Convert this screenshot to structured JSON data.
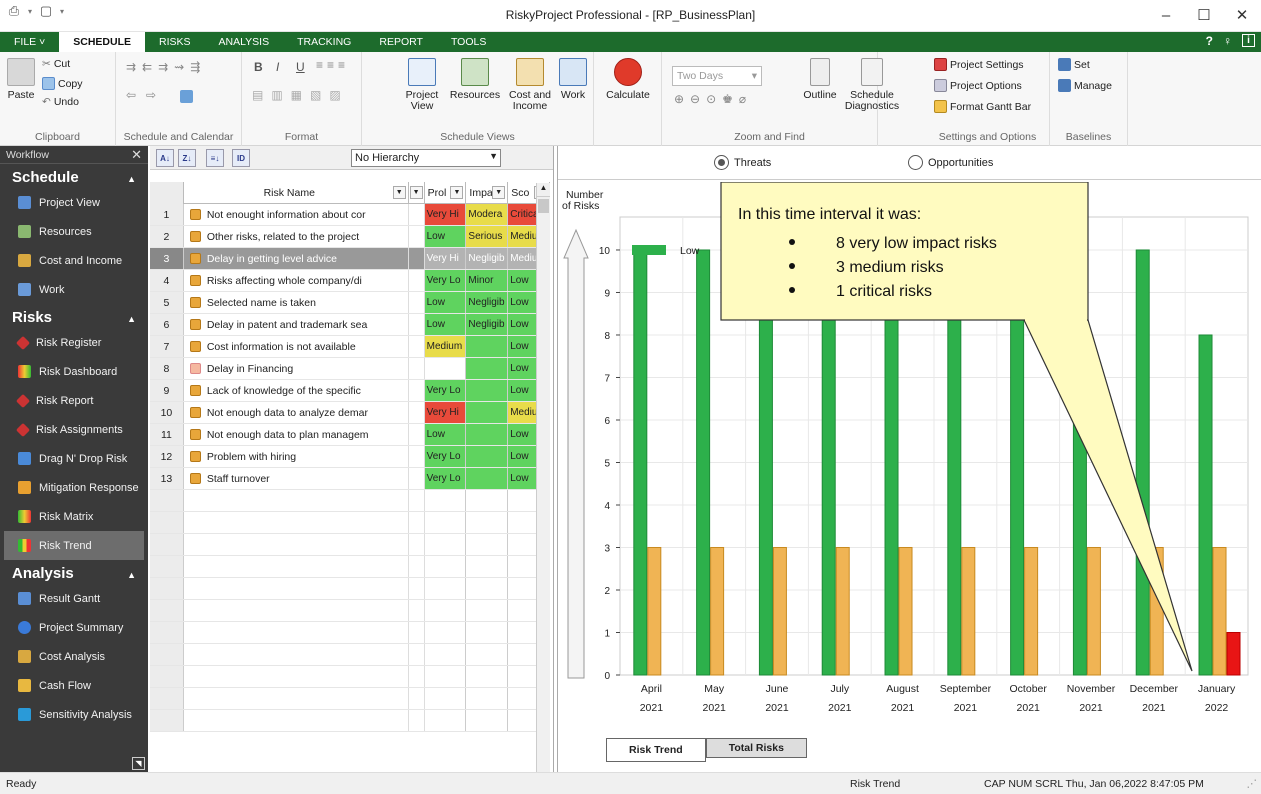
{
  "window": {
    "title": "RiskyProject Professional - [RP_BusinessPlan]",
    "minimize": "–",
    "maximize": "☐",
    "close": "✕"
  },
  "ribbon_tabs": [
    "FILE ˅",
    "SCHEDULE",
    "RISKS",
    "ANALYSIS",
    "TRACKING",
    "REPORT",
    "TOOLS"
  ],
  "ribbon_right": {
    "help": "?",
    "comment": "♀",
    "info": "i"
  },
  "clipboard": {
    "paste": "Paste",
    "cut": "Cut",
    "copy": "Copy",
    "undo": "Undo",
    "group": "Clipboard"
  },
  "groups": {
    "schedule_calendar": "Schedule and Calendar",
    "format": "Format",
    "schedule_views": "Schedule Views",
    "zoom_find": "Zoom and Find",
    "settings_options": "Settings and Options",
    "baselines": "Baselines"
  },
  "format": {
    "bold": "B",
    "italic": "I",
    "underline": "U"
  },
  "views": {
    "project": "Project View",
    "resources": "Resources",
    "cost": "Cost and Income",
    "work": "Work"
  },
  "calculate": "Calculate",
  "zoom": {
    "combo": "Two Days",
    "outline": "Outline",
    "diagnostics": "Schedule Diagnostics"
  },
  "settings": {
    "project_settings": "Project Settings",
    "project_options": "Project Options",
    "format_gantt": "Format Gantt Bar"
  },
  "baselines": {
    "set": "Set",
    "manage": "Manage"
  },
  "workflow": {
    "title": "Workflow",
    "close": "✕",
    "sections": [
      {
        "name": "Schedule",
        "items": [
          "Project View",
          "Resources",
          "Cost and Income",
          "Work"
        ]
      },
      {
        "name": "Risks",
        "items": [
          "Risk Register",
          "Risk Dashboard",
          "Risk Report",
          "Risk Assignments",
          "Drag N' Drop Risk",
          "Mitigation Response",
          "Risk Matrix",
          "Risk Trend"
        ]
      },
      {
        "name": "Analysis",
        "items": [
          "Result Gantt",
          "Project Summary",
          "Cost Analysis",
          "Cash Flow",
          "Sensitivity Analysis"
        ]
      }
    ],
    "caret": "▲",
    "active": "Risk Trend"
  },
  "grid": {
    "hierarchy": "No Hierarchy",
    "headers": {
      "name": "Risk Name",
      "prob": "Prol",
      "impact": "Impa",
      "score": "Sco"
    },
    "rows": [
      {
        "n": "1",
        "name": "Not enought information about cor",
        "prob": "Very Hi",
        "impact": "Modera",
        "score": "Critical"
      },
      {
        "n": "2",
        "name": "Other risks, related to the project",
        "prob": "Low",
        "impact": "Serious",
        "score": "Medium"
      },
      {
        "n": "3",
        "name": "Delay in getting level advice",
        "prob": "Very Hi",
        "impact": "Negligib",
        "score": "Medium"
      },
      {
        "n": "4",
        "name": "Risks affecting whole company/di",
        "prob": "Very Lo",
        "impact": "Minor",
        "score": "Low"
      },
      {
        "n": "5",
        "name": "Selected name is taken",
        "prob": "Low",
        "impact": "Negligib",
        "score": "Low"
      },
      {
        "n": "6",
        "name": "Delay in patent and trademark sea",
        "prob": "Low",
        "impact": "Negligib",
        "score": "Low"
      },
      {
        "n": "7",
        "name": "Cost information is not available",
        "prob": "Medium",
        "impact": "",
        "score": "Low"
      },
      {
        "n": "8",
        "name": "Delay in Financing",
        "prob": "",
        "impact": "",
        "score": "Low"
      },
      {
        "n": "9",
        "name": "Lack of knowledge of the specific",
        "prob": "Very Lo",
        "impact": "",
        "score": "Low"
      },
      {
        "n": "10",
        "name": "Not enough data to analyze demar",
        "prob": "Very Hi",
        "impact": "",
        "score": "Medium"
      },
      {
        "n": "11",
        "name": "Not enough data to plan managem",
        "prob": "Low",
        "impact": "",
        "score": "Low"
      },
      {
        "n": "12",
        "name": "Problem with hiring",
        "prob": "Very Lo",
        "impact": "",
        "score": "Low"
      },
      {
        "n": "13",
        "name": "Staff turnover",
        "prob": "Very Lo",
        "impact": "",
        "score": "Low"
      }
    ]
  },
  "radios": {
    "threats": "Threats",
    "opportunities": "Opportunities"
  },
  "chart_data": {
    "type": "bar",
    "ylabel": "Number of Risks",
    "ylim": [
      0,
      10
    ],
    "yticks": [
      "0",
      "1",
      "2",
      "3",
      "4",
      "5",
      "6",
      "7",
      "8",
      "9",
      "10"
    ],
    "categories": [
      [
        "April",
        "2021"
      ],
      [
        "May",
        "2021"
      ],
      [
        "June",
        "2021"
      ],
      [
        "July",
        "2021"
      ],
      [
        "August",
        "2021"
      ],
      [
        "September",
        "2021"
      ],
      [
        "October",
        "2021"
      ],
      [
        "November",
        "2021"
      ],
      [
        "December",
        "2021"
      ],
      [
        "January",
        "2022"
      ]
    ],
    "series": [
      {
        "name": "Low",
        "color": "#2db04b",
        "values": [
          10,
          10,
          10,
          10,
          10,
          10,
          10,
          10,
          10,
          8
        ]
      },
      {
        "name": "",
        "color": "#f0b454",
        "values": [
          3,
          3,
          3,
          3,
          3,
          3,
          3,
          3,
          3,
          3
        ]
      },
      {
        "name": "",
        "color": "#e81515",
        "values": [
          0,
          0,
          0,
          0,
          0,
          0,
          0,
          0,
          0,
          1
        ]
      }
    ]
  },
  "callout": {
    "title": "In this time interval it was:",
    "bullets": [
      "8 very low impact risks",
      "3 medium risks",
      "1 critical risks"
    ]
  },
  "chart_tabs": [
    "Risk Trend",
    "Total Risks"
  ],
  "status": {
    "left": "Ready",
    "mid": "Risk Trend",
    "right": "CAP  NUM  SCRL  Thu, Jan 06,2022  8:47:05 PM"
  }
}
